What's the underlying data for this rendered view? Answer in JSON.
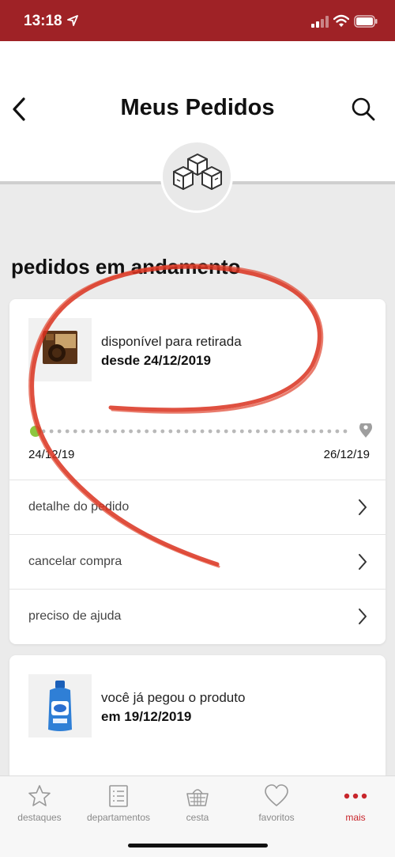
{
  "status_bar": {
    "time": "13:18"
  },
  "header": {
    "title": "Meus Pedidos"
  },
  "section": {
    "title": "pedidos em andamento"
  },
  "orders": [
    {
      "status": "disponível para retirada",
      "date_text": "desde 24/12/2019",
      "start_date": "24/12/19",
      "end_date": "26/12/19",
      "progress": 0,
      "actions": [
        "detalhe do pedido",
        "cancelar compra",
        "preciso de ajuda"
      ]
    },
    {
      "status": "você já pegou o produto",
      "date_text": "em 19/12/2019"
    }
  ],
  "tabs": [
    {
      "label": "destaques",
      "icon": "star-icon"
    },
    {
      "label": "departamentos",
      "icon": "list-icon"
    },
    {
      "label": "cesta",
      "icon": "basket-icon"
    },
    {
      "label": "favoritos",
      "icon": "heart-icon"
    },
    {
      "label": "mais",
      "icon": "more-dots-icon",
      "active": true
    }
  ],
  "colors": {
    "brand": "#9f2226",
    "accent": "#c8262c",
    "progress_done": "#8dc63f",
    "annotation": "#d9311f"
  }
}
